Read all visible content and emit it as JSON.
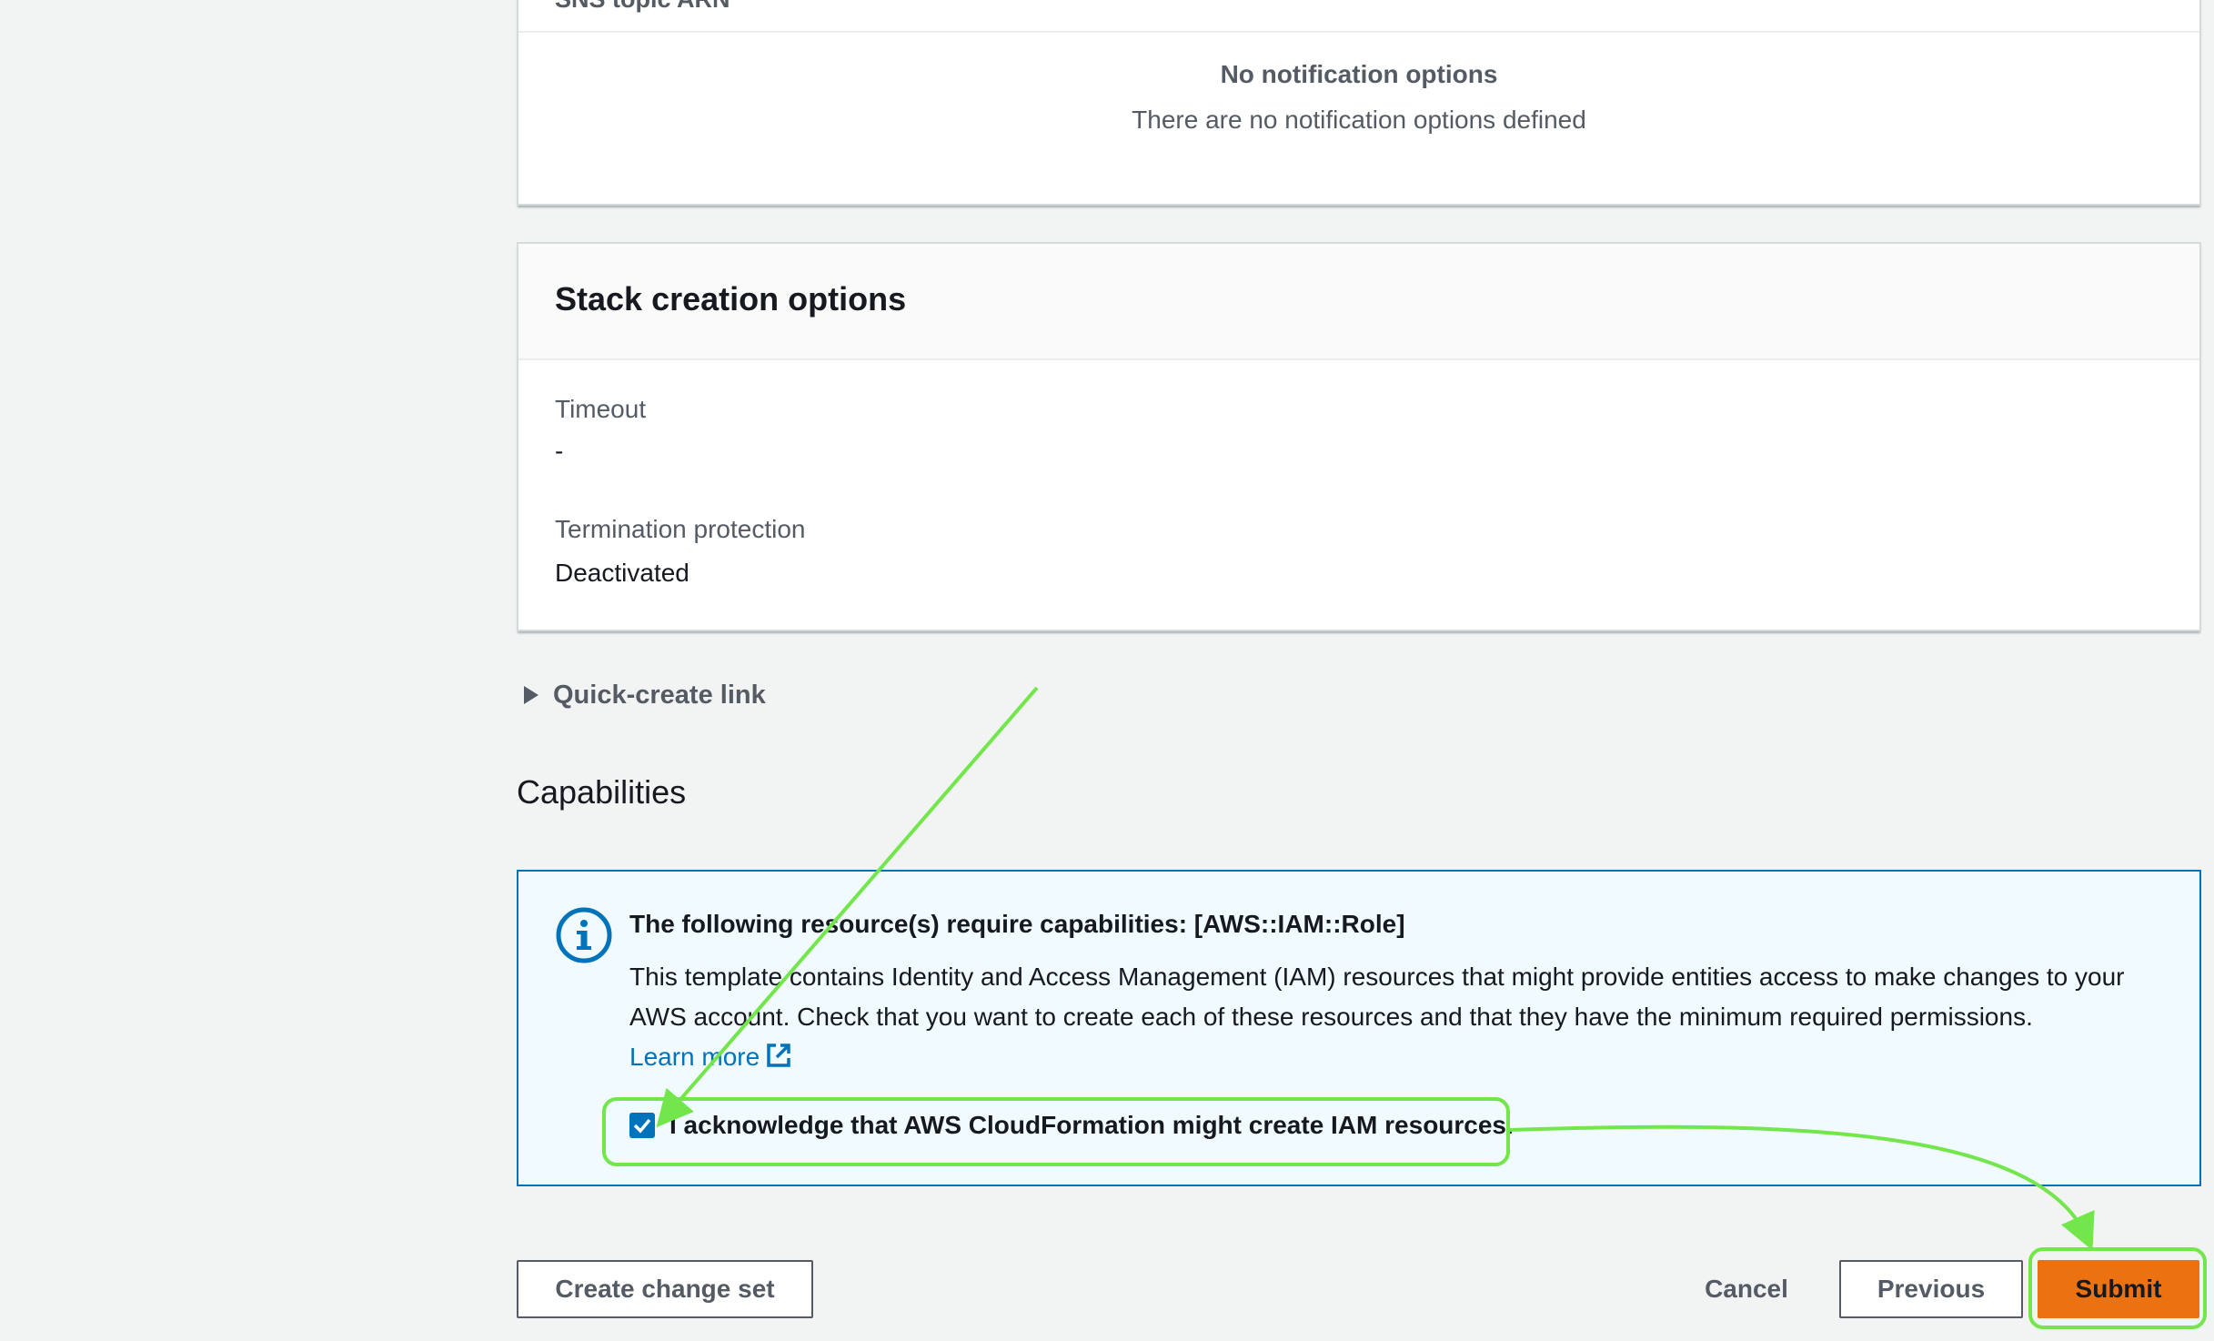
{
  "notification_panel": {
    "clipped_header": "SNS topic ARN",
    "empty_title": "No notification options",
    "empty_description": "There are no notification options defined"
  },
  "stack_creation_options": {
    "title": "Stack creation options",
    "timeout_label": "Timeout",
    "timeout_value": "-",
    "termination_label": "Termination protection",
    "termination_value": "Deactivated"
  },
  "quick_create": {
    "label": "Quick-create link",
    "expanded": false
  },
  "capabilities": {
    "heading": "Capabilities",
    "alert_title": "The following resource(s) require capabilities: [AWS::IAM::Role]",
    "alert_body": "This template contains Identity and Access Management (IAM) resources that might provide entities access to make changes to your AWS account. Check that you want to create each of these resources and that they have the minimum required permissions.",
    "learn_more": "Learn more",
    "acknowledge_label": "I acknowledge that AWS CloudFormation might create IAM resources.",
    "acknowledge_checked": true
  },
  "footer": {
    "create_change_set": "Create change set",
    "cancel": "Cancel",
    "previous": "Previous",
    "submit": "Submit"
  },
  "colors": {
    "page_background": "#f2f3f3",
    "info_blue": "#0073bb",
    "primary_orange": "#ec7211",
    "annotation_green": "#72e64b"
  },
  "icons": {
    "info": "info-circle-icon",
    "external": "external-link-icon",
    "caret": "caret-right-icon",
    "check": "checkmark-icon"
  }
}
